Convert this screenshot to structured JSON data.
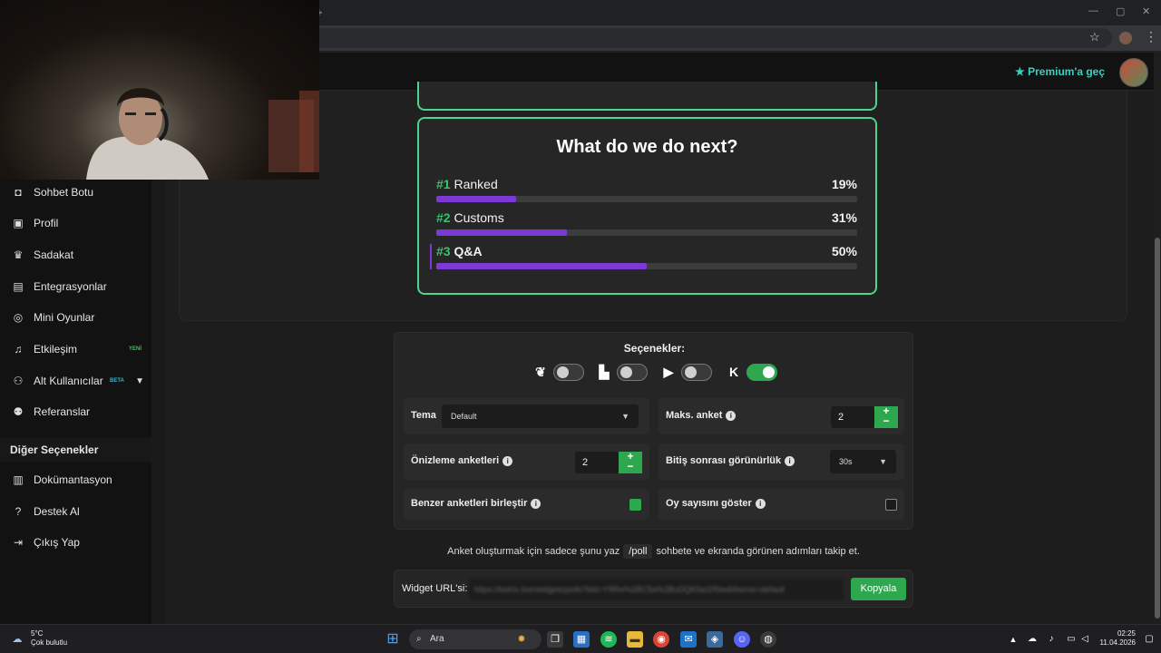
{
  "browser": {
    "new_tab": "+",
    "minimize": "—",
    "maximize": "▢",
    "close": "✕"
  },
  "topbar": {
    "premium_label": "Premium'a geç"
  },
  "sidebar": {
    "items": [
      {
        "label": "Sohbet Botu",
        "icon": "robot-icon"
      },
      {
        "label": "Profil",
        "icon": "id-card-icon"
      },
      {
        "label": "Sadakat",
        "icon": "trophy-icon"
      },
      {
        "label": "Entegrasyonlar",
        "icon": "integration-icon"
      },
      {
        "label": "Mini Oyunlar",
        "icon": "gamepad-icon"
      },
      {
        "label": "Etkileşim",
        "icon": "music-note-icon",
        "badge": "YENİ"
      },
      {
        "label": "Alt Kullanıcılar",
        "icon": "users-icon",
        "badge": "BETA"
      },
      {
        "label": "Referanslar",
        "icon": "user-group-icon"
      }
    ],
    "section_title": "Diğer Seçenekler",
    "other_items": [
      {
        "label": "Dokümantasyon",
        "icon": "document-icon"
      },
      {
        "label": "Destek Al",
        "icon": "help-icon"
      },
      {
        "label": "Çıkış Yap",
        "icon": "logout-icon"
      }
    ]
  },
  "poll": {
    "title": "What do we do next?",
    "options": [
      {
        "num": "#1",
        "label": "Ranked",
        "percent_label": "19%",
        "percent": 19
      },
      {
        "num": "#2",
        "label": "Customs",
        "percent_label": "31%",
        "percent": 31
      },
      {
        "num": "#3",
        "label": "Q&A",
        "percent_label": "50%",
        "percent": 50
      }
    ],
    "accent_color": "#4bd68a",
    "bar_color": "#7b3ad6"
  },
  "options": {
    "title": "Seçenekler:",
    "platforms": [
      {
        "name": "kick-logo-icon",
        "enabled": false
      },
      {
        "name": "twitch-icon",
        "enabled": false
      },
      {
        "name": "youtube-icon",
        "enabled": false
      },
      {
        "name": "kick-icon",
        "enabled": true
      }
    ],
    "theme_label": "Tema",
    "theme_value": "Default",
    "max_polls_label": "Maks. anket",
    "max_polls_value": "2",
    "preview_polls_label": "Önizleme anketleri",
    "preview_polls_value": "2",
    "post_visibility_label": "Bitiş sonrası görünürlük",
    "post_visibility_value": "30s",
    "merge_label": "Benzer anketleri birleştir",
    "merge_checked": true,
    "show_votes_label": "Oy sayısını göster",
    "show_votes_checked": false
  },
  "hint": {
    "before": "Anket oluşturmak için sadece şunu yaz",
    "command": "/poll",
    "after": "sohbete ve ekranda görünen adımları takip et."
  },
  "widget": {
    "label": "Widget URL'si:",
    "url": "https://botrix.live/widgets/polls?bid=Y9Rw%2BC5a%2BuDQK5w1Rbw&theme=default",
    "copy_label": "Kopyala"
  },
  "taskbar": {
    "temperature": "5°C",
    "weather": "Çok bulutlu",
    "search_label": "Ara",
    "time": "02:25",
    "date": "11.04.2026"
  }
}
